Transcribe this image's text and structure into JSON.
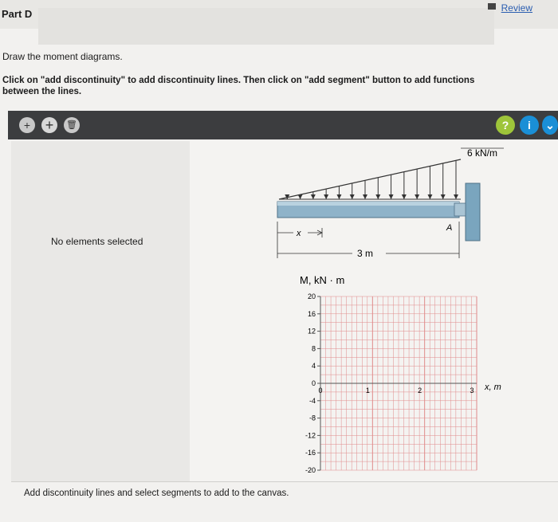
{
  "header": {
    "part_title": "Part D",
    "review_label": "Review"
  },
  "instructions": {
    "line1": "Draw the moment diagrams.",
    "line2": "Click on \"add discontinuity\" to add discontinuity lines. Then click on \"add segment\" button to add functions between the lines."
  },
  "toolbar": {
    "add_discontinuity_label": "+",
    "add_segment_label": "+",
    "delete_label": "🗑",
    "hint_label": "?",
    "info_label": "i"
  },
  "side_panel": {
    "status": "No elements selected"
  },
  "figure": {
    "load_label": "6 kN/m",
    "support_label": "A",
    "x_dim_label": "x",
    "length_label": "3 m"
  },
  "chart_data": {
    "type": "line",
    "ylabel": "M, kN · m",
    "xlabel": "x, m",
    "ylim": [
      -20,
      20
    ],
    "xlim": [
      0,
      3
    ],
    "yticks": [
      20,
      16,
      12,
      8,
      4,
      0,
      -4,
      -8,
      -12,
      -16,
      -20
    ],
    "xticks": [
      0,
      1,
      2,
      3
    ],
    "grid": true,
    "series": []
  },
  "footer": {
    "message": "Add discontinuity lines and select segments to add to the canvas."
  },
  "colors": {
    "toolbar": "#3c3d3f",
    "grid": "#e08a8a",
    "hint_button": "#9ec53a",
    "info_button": "#1a8fd6"
  }
}
